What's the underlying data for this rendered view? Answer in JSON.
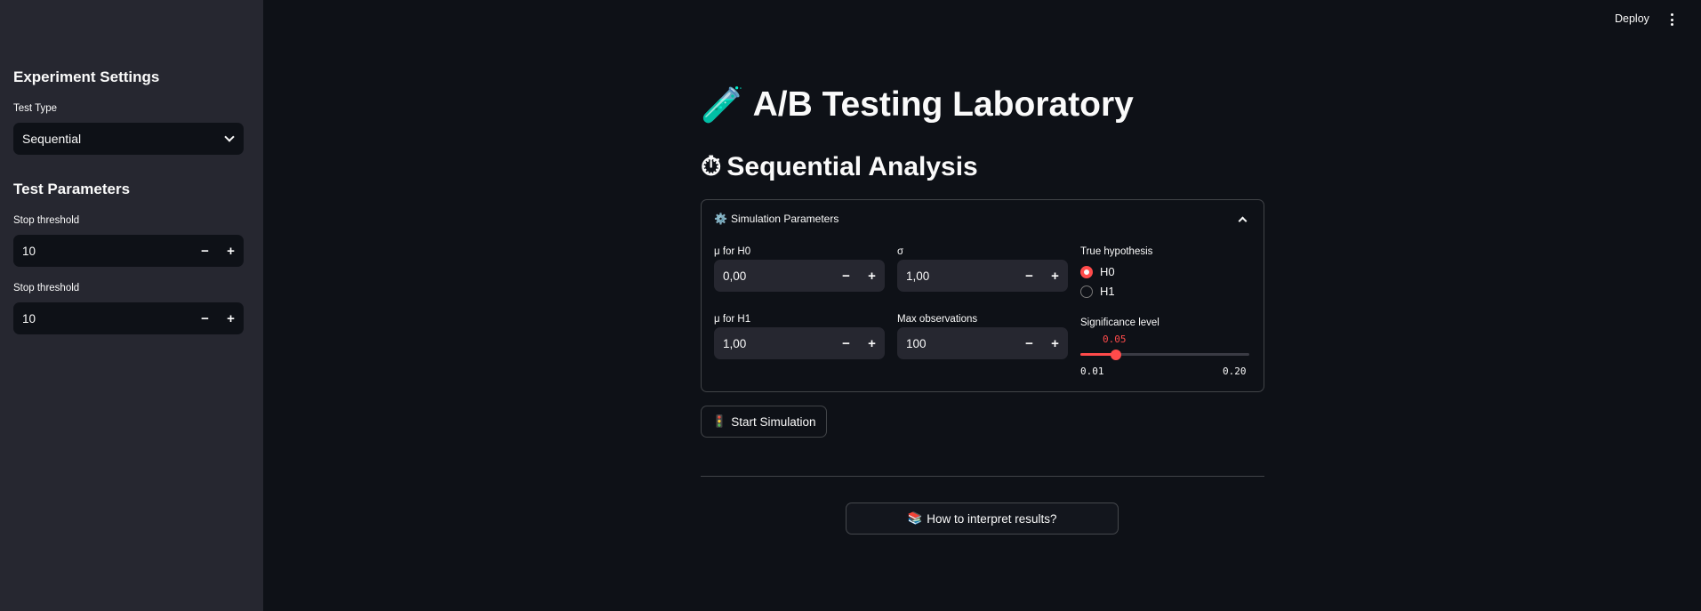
{
  "header": {
    "deploy_label": "Deploy",
    "menu_icon": "kebab-menu-icon"
  },
  "sidebar": {
    "experiment_settings_title": "Experiment Settings",
    "test_type": {
      "label": "Test Type",
      "selected": "Sequential"
    },
    "test_parameters_title": "Test Parameters",
    "stop_threshold_1": {
      "label": "Stop threshold",
      "value": "10"
    },
    "stop_threshold_2": {
      "label": "Stop threshold",
      "value": "10"
    }
  },
  "main": {
    "title_emoji": "🧪",
    "title": "A/B Testing Laboratory",
    "subtitle_emoji": "⏱",
    "subtitle": "Sequential Analysis",
    "expander": {
      "icon": "⚙️",
      "label": "Simulation Parameters",
      "expanded": true
    },
    "params": {
      "mu_h0": {
        "label": "μ for H0",
        "value": "0,00"
      },
      "sigma": {
        "label": "σ",
        "value": "1,00"
      },
      "mu_h1": {
        "label": "μ for H1",
        "value": "1,00"
      },
      "max_obs": {
        "label": "Max observations",
        "value": "100"
      },
      "true_hypothesis": {
        "label": "True hypothesis",
        "options": [
          "H0",
          "H1"
        ],
        "selected": "H0"
      },
      "significance": {
        "label": "Significance level",
        "value": "0.05",
        "min": "0.01",
        "max": "0.20",
        "fraction": 0.2105
      }
    },
    "stepper_minus": "−",
    "stepper_plus": "+",
    "start_button": {
      "icon": "🚦",
      "label": "Start Simulation"
    },
    "help_button": {
      "icon": "📚",
      "label": "How to interpret results?"
    }
  },
  "colors": {
    "accent": "#ff4b4b",
    "background": "#0e1117",
    "sidebar": "#262730",
    "text": "#fafafa"
  }
}
